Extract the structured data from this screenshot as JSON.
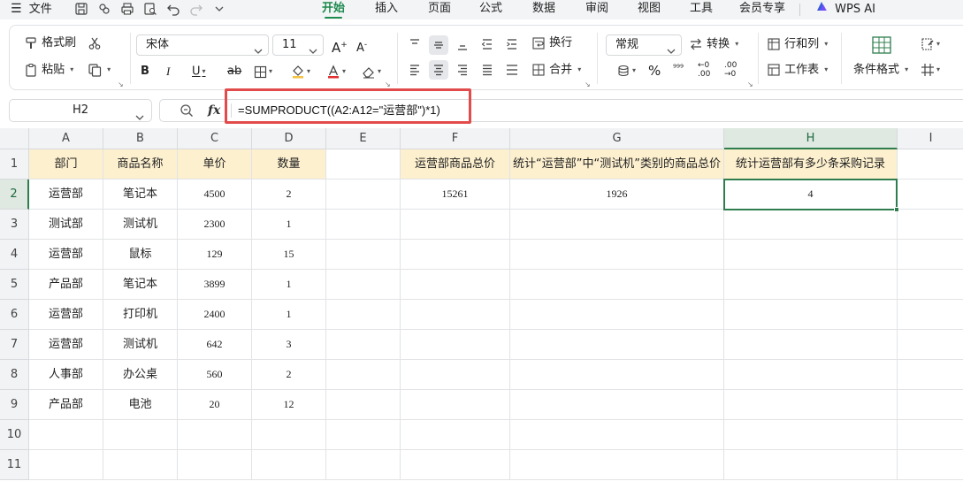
{
  "menubar": {
    "file_label": "文件",
    "tabs": [
      {
        "label": "开始",
        "active": true
      },
      {
        "label": "插入",
        "active": false
      },
      {
        "label": "页面",
        "active": false
      },
      {
        "label": "公式",
        "active": false
      },
      {
        "label": "数据",
        "active": false
      },
      {
        "label": "审阅",
        "active": false
      },
      {
        "label": "视图",
        "active": false
      },
      {
        "label": "工具",
        "active": false
      },
      {
        "label": "会员专享",
        "active": false
      }
    ],
    "ai_label": "WPS AI",
    "accent_color": "#1d8a4e"
  },
  "ribbon": {
    "format_painter": "格式刷",
    "paste": "粘贴",
    "font_name": "宋体",
    "font_size": "11",
    "wrap_text": "换行",
    "merge": "合并",
    "number_format": "常规",
    "convert": "转换",
    "percent_symbol": "%",
    "rows_cols": "行和列",
    "worksheet": "工作表",
    "conditional_format": "条件格式"
  },
  "formula_bar": {
    "cell_ref": "H2",
    "fx_label": "fx",
    "formula": "=SUMPRODUCT((A2:A12=\"运营部\")*1)",
    "highlight_color": "#e14b4b"
  },
  "sheet": {
    "columns": [
      "A",
      "B",
      "C",
      "D",
      "E",
      "F",
      "G",
      "H",
      "I"
    ],
    "selected_column": "H",
    "rows": [
      "1",
      "2",
      "3",
      "4",
      "5",
      "6",
      "7",
      "8",
      "9",
      "10",
      "11"
    ],
    "selected_row": "2",
    "header_fill_color": "#fdf0cf",
    "cells": {
      "A1": "部门",
      "B1": "商品名称",
      "C1": "单价",
      "D1": "数量",
      "F1": "运营部商品总价",
      "G1": "统计“运营部”中“测试机”类别的商品总价",
      "H1": "统计运营部有多少条采购记录",
      "A2": "运营部",
      "B2": "笔记本",
      "C2": "4500",
      "D2": "2",
      "F2": "15261",
      "G2": "1926",
      "H2": "4",
      "A3": "测试部",
      "B3": "测试机",
      "C3": "2300",
      "D3": "1",
      "A4": "运营部",
      "B4": "鼠标",
      "C4": "129",
      "D4": "15",
      "A5": "产品部",
      "B5": "笔记本",
      "C5": "3899",
      "D5": "1",
      "A6": "运营部",
      "B6": "打印机",
      "C6": "2400",
      "D6": "1",
      "A7": "运营部",
      "B7": "测试机",
      "C7": "642",
      "D7": "3",
      "A8": "人事部",
      "B8": "办公桌",
      "C8": "560",
      "D8": "2",
      "A9": "产品部",
      "B9": "电池",
      "C9": "20",
      "D9": "12"
    }
  }
}
